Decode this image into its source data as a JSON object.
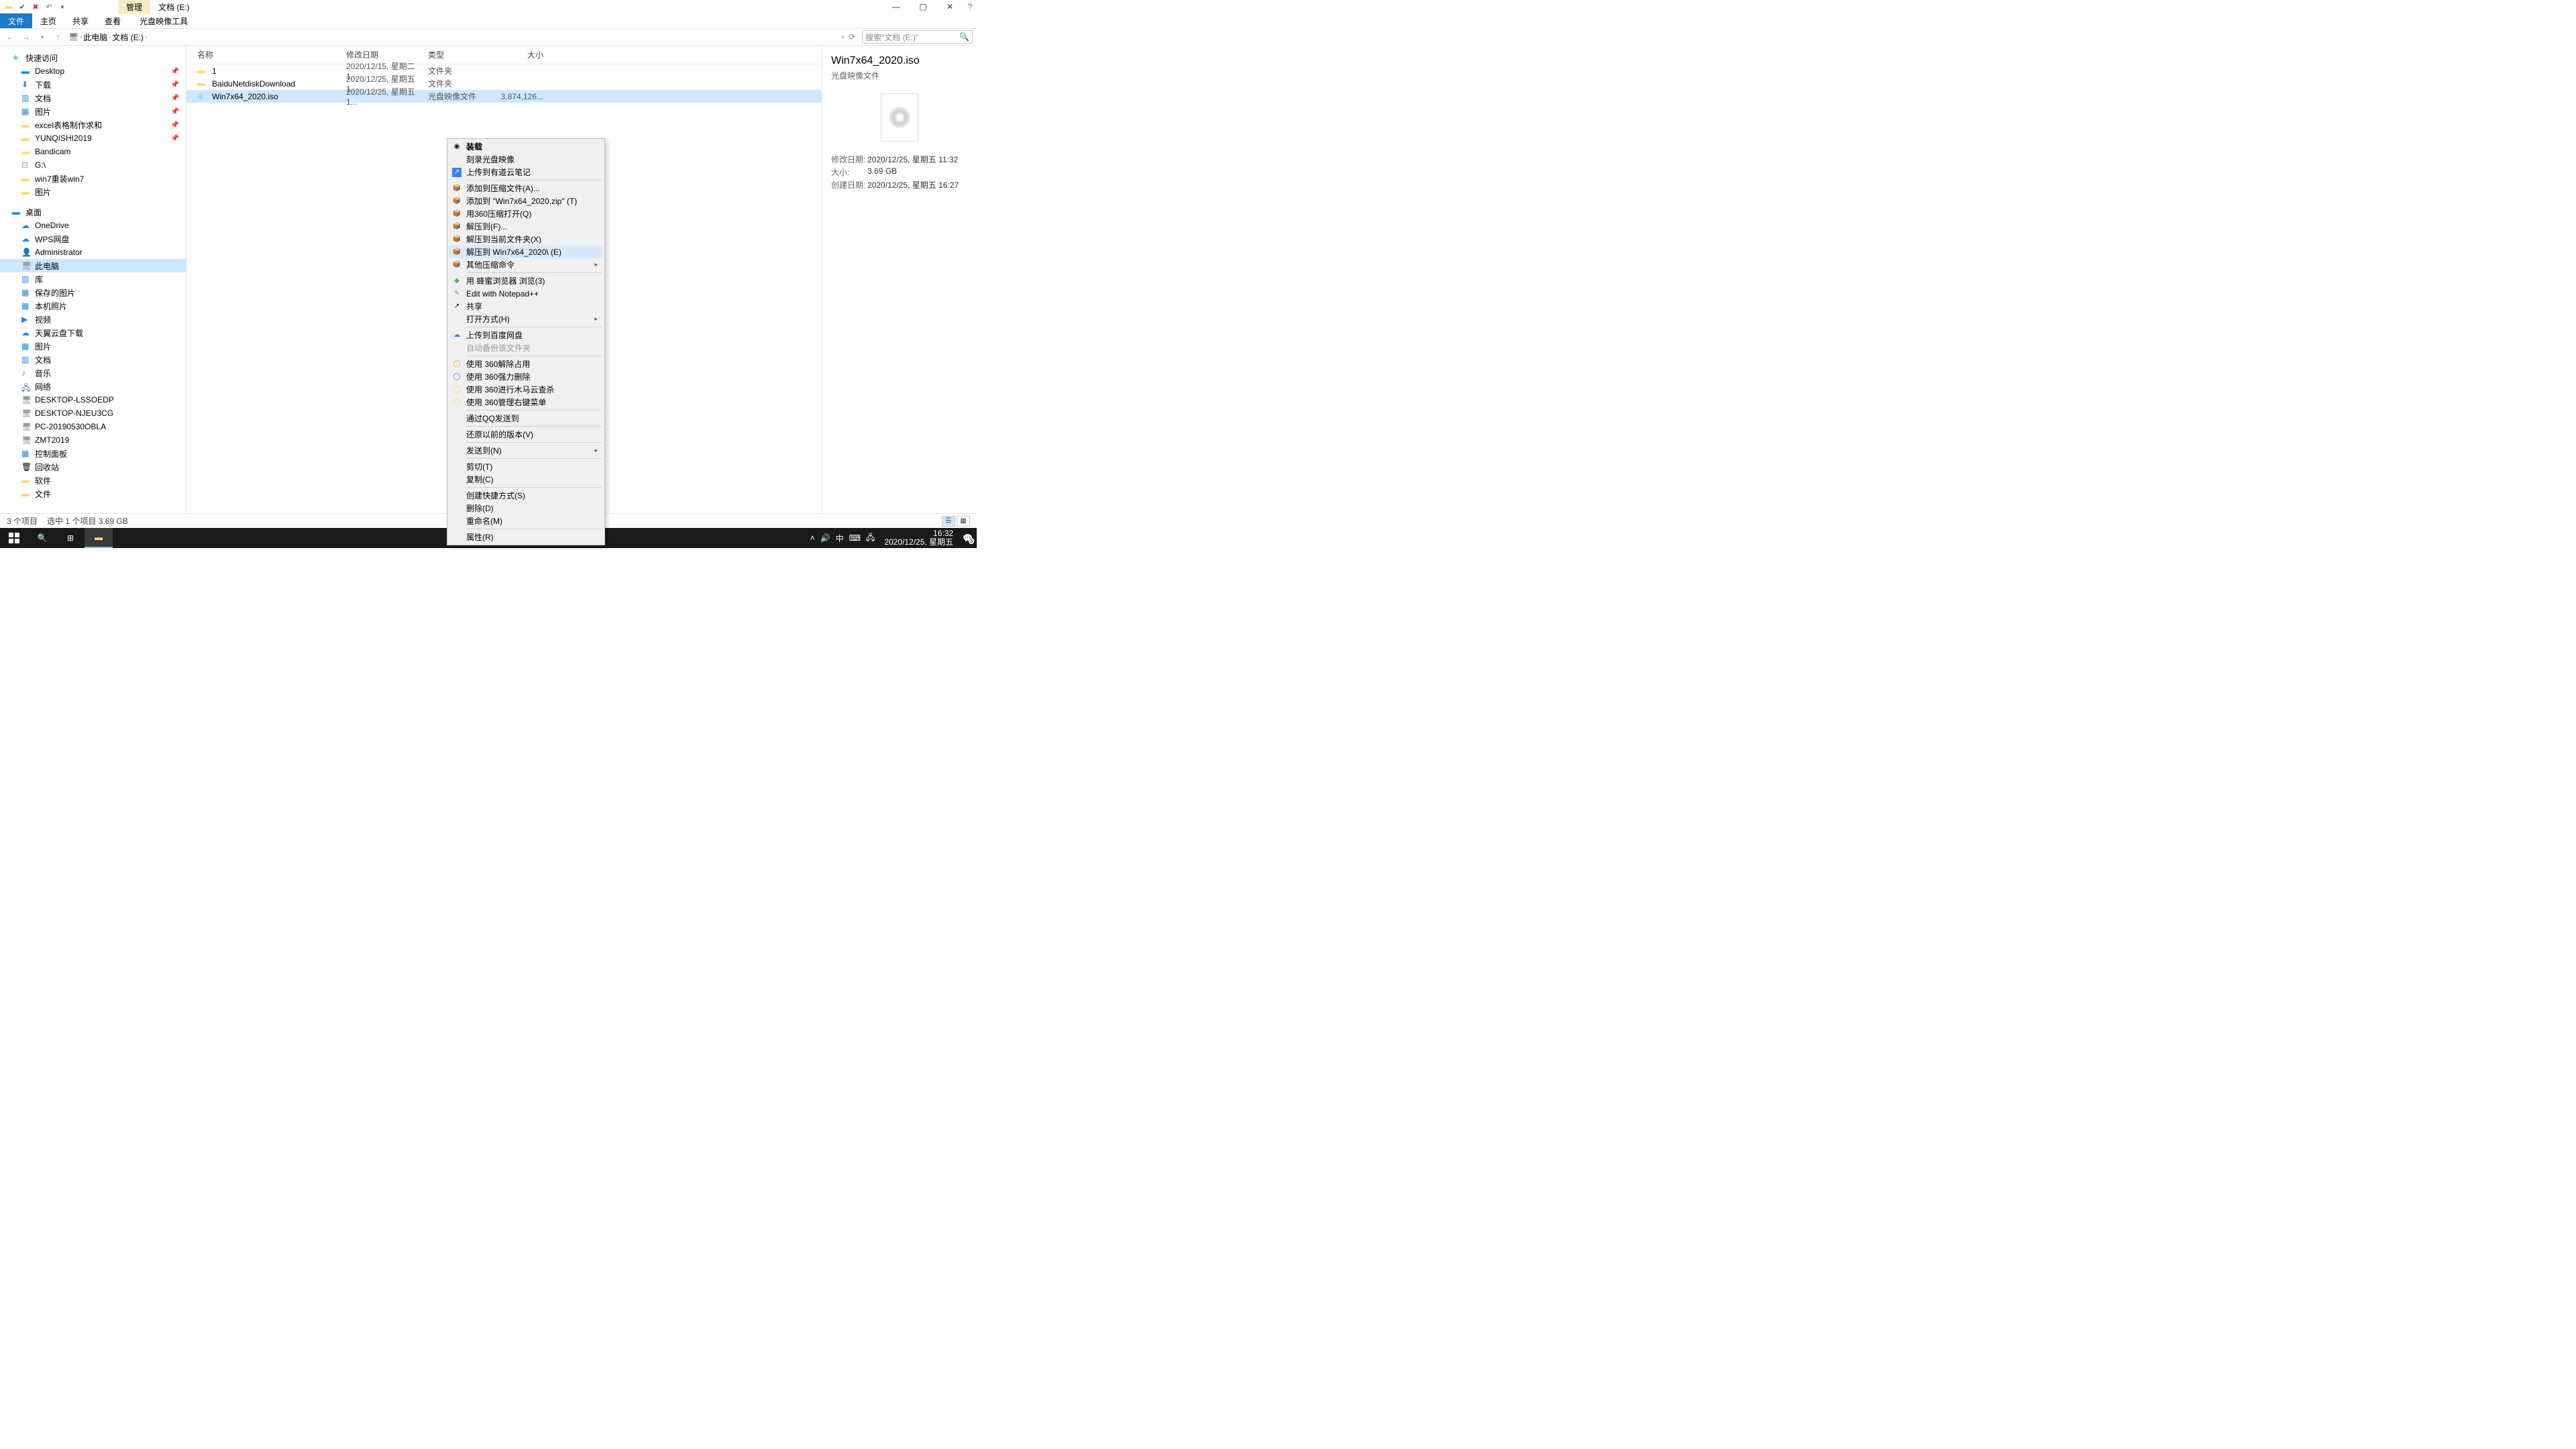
{
  "title_tabs": {
    "manage": "管理",
    "drive": "文档 (E:)"
  },
  "ribbon": {
    "file": "文件",
    "home": "主页",
    "share": "共享",
    "view": "查看",
    "disc": "光盘映像工具"
  },
  "breadcrumb": {
    "pc": "此电脑",
    "drive": "文档 (E:)"
  },
  "search_placeholder": "搜索\"文档 (E:)\"",
  "nav": {
    "quick": "快速访问",
    "desktop": "Desktop",
    "downloads": "下载",
    "documents": "文档",
    "pictures": "图片",
    "excel": "excel表格制作求和",
    "yunqishi": "YUNQISHI2019",
    "bandicam": "Bandicam",
    "g": "G:\\",
    "win7": "win7重装win7",
    "pictures2": "图片",
    "desk": "桌面",
    "onedrive": "OneDrive",
    "wps": "WPS网盘",
    "admin": "Administrator",
    "thispc": "此电脑",
    "lib": "库",
    "savedpic": "保存的图片",
    "localpic": "本机照片",
    "video": "视频",
    "tianyi": "天翼云盘下载",
    "pictures3": "图片",
    "docs2": "文档",
    "music": "音乐",
    "network": "网络",
    "d1": "DESKTOP-LSSOEDP",
    "d2": "DESKTOP-NJEU3CG",
    "d3": "PC-20190530OBLA",
    "d4": "ZMT2019",
    "cp": "控制面板",
    "recycle": "回收站",
    "soft": "软件",
    "files": "文件"
  },
  "cols": {
    "name": "名称",
    "date": "修改日期",
    "type": "类型",
    "size": "大小"
  },
  "rows": [
    {
      "name": "1",
      "date": "2020/12/15, 星期二 1...",
      "type": "文件夹",
      "size": ""
    },
    {
      "name": "BaiduNetdiskDownload",
      "date": "2020/12/25, 星期五 1...",
      "type": "文件夹",
      "size": ""
    },
    {
      "name": "Win7x64_2020.iso",
      "date": "2020/12/25, 星期五 1...",
      "type": "光盘映像文件",
      "size": "3,874,126..."
    }
  ],
  "ctx": {
    "mount": "装载",
    "burn": "刻录光盘映像",
    "youdao": "上传到有道云笔记",
    "addarc": "添加到压缩文件(A)...",
    "addzip": "添加到 \"Win7x64_2020.zip\" (T)",
    "open360": "用360压缩打开(Q)",
    "extractf": "解压到(F)...",
    "extractcur": "解压到当前文件夹(X)",
    "extractto": "解压到 Win7x64_2020\\ (E)",
    "otherarc": "其他压缩命令",
    "browse": "用 蜂蜜浏览器 浏览(3)",
    "notepad": "Edit with Notepad++",
    "share": "共享",
    "openwith": "打开方式(H)",
    "baidu": "上传到百度网盘",
    "autobak": "自动备份该文件夹",
    "u360a": "使用 360解除占用",
    "u360b": "使用 360强力删除",
    "u360c": "使用 360进行木马云查杀",
    "u360d": "使用 360管理右键菜单",
    "qq": "通过QQ发送到",
    "restore": "还原以前的版本(V)",
    "sendto": "发送到(N)",
    "cut": "剪切(T)",
    "copy": "复制(C)",
    "shortcut": "创建快捷方式(S)",
    "delete": "删除(D)",
    "rename": "重命名(M)",
    "props": "属性(R)"
  },
  "details": {
    "title": "Win7x64_2020.iso",
    "sub": "光盘映像文件",
    "mod_l": "修改日期:",
    "mod_v": "2020/12/25, 星期五 11:32",
    "size_l": "大小:",
    "size_v": "3.69 GB",
    "cre_l": "创建日期:",
    "cre_v": "2020/12/25, 星期五 16:27"
  },
  "status": {
    "items": "3 个项目",
    "sel": "选中 1 个项目  3.69 GB"
  },
  "tray": {
    "ime": "中",
    "time": "16:32",
    "date": "2020/12/25, 星期五",
    "badge": "3"
  }
}
